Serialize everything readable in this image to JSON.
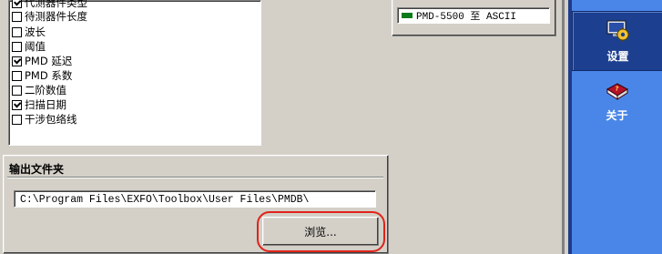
{
  "checklist": {
    "items": [
      {
        "label": "代测器件类型",
        "checked": true
      },
      {
        "label": "待测器件长度",
        "checked": false
      },
      {
        "label": "波长",
        "checked": false
      },
      {
        "label": "阈值",
        "checked": false
      },
      {
        "label": "PMD 延迟",
        "checked": true
      },
      {
        "label": "PMD 系数",
        "checked": false
      },
      {
        "label": "二阶数值",
        "checked": false
      },
      {
        "label": "扫描日期",
        "checked": true
      },
      {
        "label": "干涉包络线",
        "checked": false
      }
    ]
  },
  "output_folder": {
    "title": "输出文件夹",
    "path": "C:\\Program Files\\EXFO\\Toolbox\\User Files\\PMDB\\",
    "browse_label": "浏览..."
  },
  "export_format": {
    "item_label": "PMD-5500 至 ASCII"
  },
  "side_nav": {
    "items": [
      {
        "label": "设置",
        "icon": "settings-gear-icon",
        "active": true
      },
      {
        "label": "关于",
        "icon": "help-book-icon",
        "active": false
      }
    ]
  },
  "colors": {
    "highlight_ring": "#e0231b",
    "side_pane": "#4a86e8",
    "active_nav": "#1d3f8f"
  }
}
